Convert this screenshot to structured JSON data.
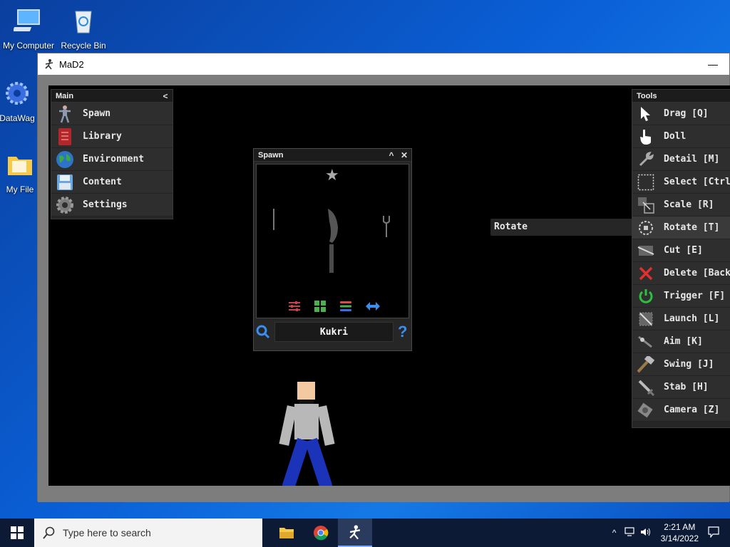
{
  "desktop": {
    "icons": [
      {
        "label": "My Computer"
      },
      {
        "label": "Recycle Bin"
      },
      {
        "label": "DataWag"
      },
      {
        "label": "My File"
      }
    ]
  },
  "window": {
    "title": "MaD2",
    "minimize": "—"
  },
  "main_panel": {
    "title": "Main",
    "collapse": "<",
    "items": [
      {
        "label": "Spawn"
      },
      {
        "label": "Library"
      },
      {
        "label": "Environment"
      },
      {
        "label": "Content"
      },
      {
        "label": "Settings"
      }
    ]
  },
  "spawn_panel": {
    "title": "Spawn",
    "collapse": "^",
    "close": "✕",
    "star": "★",
    "search_value": "Kukri",
    "help": "?"
  },
  "tooltip": {
    "label": "Rotate"
  },
  "tools_panel": {
    "title": "Tools",
    "collapse": ">",
    "items": [
      {
        "label": "Drag [Q]"
      },
      {
        "label": "Doll"
      },
      {
        "label": "Detail [M]"
      },
      {
        "label": "Select [Ctrl"
      },
      {
        "label": "Scale [R]"
      },
      {
        "label": "Rotate [T]"
      },
      {
        "label": "Cut [E]"
      },
      {
        "label": "Delete [Back"
      },
      {
        "label": "Trigger [F]"
      },
      {
        "label": "Launch [L]"
      },
      {
        "label": "Aim [K]"
      },
      {
        "label": "Swing [J]"
      },
      {
        "label": "Stab [H]"
      },
      {
        "label": "Camera [Z]"
      }
    ]
  },
  "taskbar": {
    "search_placeholder": "Type here to search",
    "time": "2:21 AM",
    "date": "3/14/2022"
  },
  "colors": {
    "panel_bg": "#262626",
    "viewport_bg": "#000000",
    "delete_red": "#e03030",
    "trigger_green": "#2fbf3f",
    "accent_blue": "#3a8ef0"
  }
}
